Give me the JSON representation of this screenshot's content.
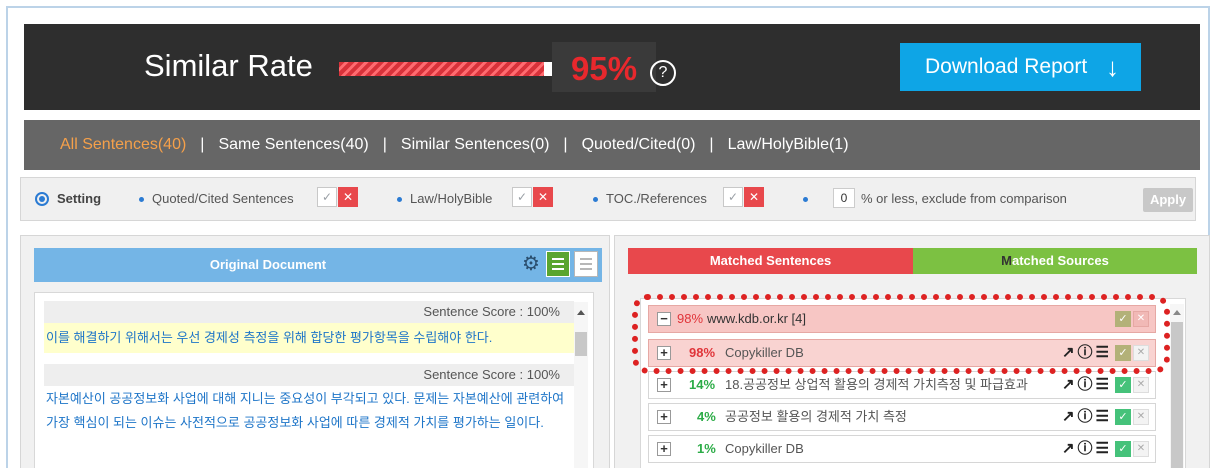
{
  "header": {
    "title": "Similar Rate",
    "percent": "95%",
    "percent_value": 95,
    "help_icon": "?",
    "download_label": "Download Report",
    "download_icon": "arrow-down-icon",
    "colors": {
      "accent_red": "#e8282d",
      "download_blue": "#0ea5e6"
    }
  },
  "tabs": [
    {
      "label": "All Sentences(40)",
      "active": true
    },
    {
      "label": "Same Sentences(40)"
    },
    {
      "label": "Similar Sentences(0)"
    },
    {
      "label": "Quoted/Cited(0)"
    },
    {
      "label": "Law/HolyBible(1)"
    }
  ],
  "tab_separator": "|",
  "setting": {
    "label": "Setting",
    "quoted": "Quoted/Cited Sentences",
    "law": "Law/HolyBible",
    "toc": "TOC./References",
    "threshold_value": "0",
    "threshold_suffix": "% or less, exclude from comparison",
    "apply": "Apply",
    "check_glyph": "✓",
    "x_glyph": "✕"
  },
  "original": {
    "title": "Original Document",
    "score_1": "Sentence Score : 100%",
    "sentence_1": "이를 해결하기 위해서는 우선 경제성 측정을 위해 합당한 평가항목을 수립해야 한다.",
    "score_2": "Sentence Score : 100%",
    "sentence_2": "자본예산이 공공정보화 사업에 대해 지니는 중요성이 부각되고 있다. 문제는 자본예산에 관련하여 가장 핵심이 되는 이슈는 사전적으로 공공정보화 사업에 따른 경제적 가치를 평가하는 일이다."
  },
  "matched": {
    "tab_matched": "Matched Sentences",
    "tab_sources_first": "M",
    "tab_sources_rest": "atched Sources",
    "rows": [
      {
        "sign": "−",
        "pct": "98%",
        "name": "www.kdb.or.kr [4]"
      },
      {
        "sign": "+",
        "pct": "98%",
        "name": "Copykiller DB"
      },
      {
        "sign": "+",
        "pct": "14%",
        "name": "18.공공정보 상업적 활용의 경제적 가치측정 및 파급효과"
      },
      {
        "sign": "+",
        "pct": "4%",
        "name": "공공정보 활용의 경제적 가치 측정"
      },
      {
        "sign": "+",
        "pct": "1%",
        "name": "Copykiller DB"
      }
    ],
    "icons": {
      "open": "↗",
      "info": "ⓘ",
      "list": "☰",
      "check": "✓",
      "x": "✕"
    }
  }
}
